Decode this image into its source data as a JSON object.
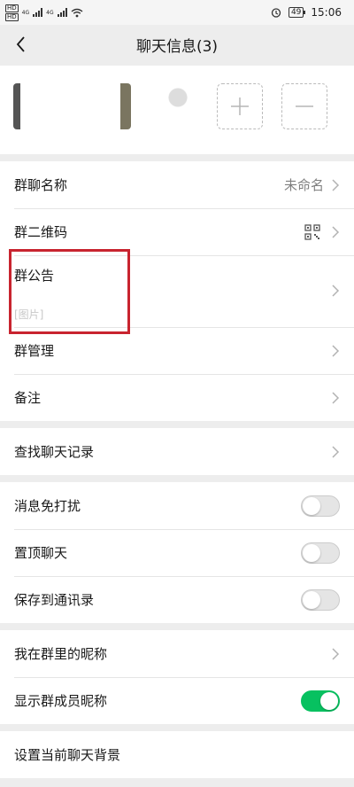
{
  "status_bar": {
    "hd1": "HD",
    "hd2": "HD",
    "net1": "4G",
    "net2": "4G",
    "battery": "49",
    "time": "15:06"
  },
  "nav": {
    "title": "聊天信息(3)"
  },
  "rows": {
    "group_name": {
      "label": "群聊名称",
      "value": "未命名"
    },
    "qr_code": {
      "label": "群二维码"
    },
    "notice": {
      "label": "群公告",
      "sub": "[图片]"
    },
    "manage": {
      "label": "群管理"
    },
    "remark": {
      "label": "备注"
    },
    "search_history": {
      "label": "查找聊天记录"
    },
    "mute": {
      "label": "消息免打扰",
      "on": false
    },
    "pin": {
      "label": "置顶聊天",
      "on": false
    },
    "save_contacts": {
      "label": "保存到通讯录",
      "on": false
    },
    "my_nickname": {
      "label": "我在群里的昵称"
    },
    "show_nicknames": {
      "label": "显示群成员昵称",
      "on": true
    },
    "set_background": {
      "label": "设置当前聊天背景"
    }
  },
  "colors": {
    "accent": "#07c160",
    "highlight": "#c8242f"
  }
}
